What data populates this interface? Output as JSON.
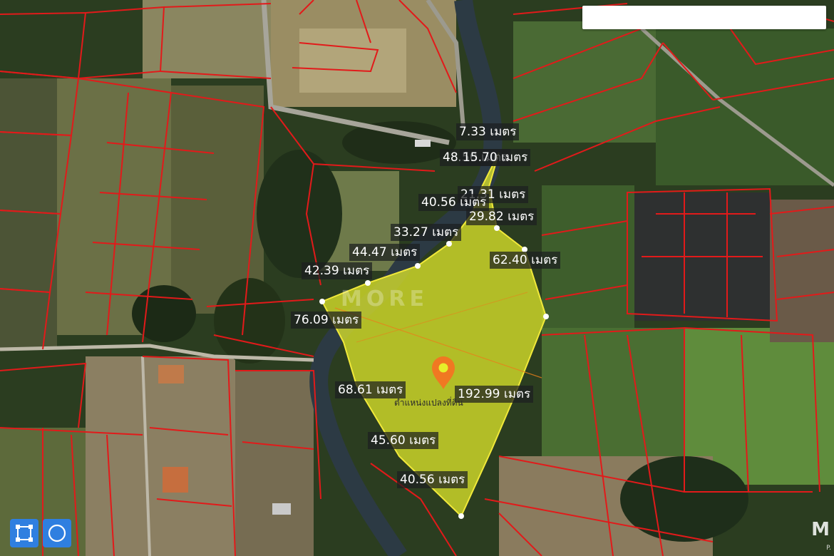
{
  "search": {
    "placeholder": ""
  },
  "colors": {
    "parcel_line": "#e21a1a",
    "polygon_fill": "#e6ef2a",
    "polygon_stroke": "#f1e93a",
    "pin": "#f07822",
    "tool_button": "#2f7fe0"
  },
  "measurements": [
    {
      "id": "m1",
      "text": "7.33 เมตร"
    },
    {
      "id": "m2",
      "text": "48.50 เมตร"
    },
    {
      "id": "m3",
      "text": "15.70 เมตร"
    },
    {
      "id": "m4",
      "text": "21.31 เมตร"
    },
    {
      "id": "m5",
      "text": "40.56 เมตร"
    },
    {
      "id": "m6",
      "text": "29.82 เมตร"
    },
    {
      "id": "m7",
      "text": "33.27 เมตร"
    },
    {
      "id": "m8",
      "text": "44.47 เมตร"
    },
    {
      "id": "m9",
      "text": "62.40 เมตร"
    },
    {
      "id": "m10",
      "text": "42.39 เมตร"
    },
    {
      "id": "m11",
      "text": "76.09 เมตร"
    },
    {
      "id": "m12",
      "text": "68.61 เมตร"
    },
    {
      "id": "m13",
      "text": "192.99 เมตร"
    },
    {
      "id": "m14",
      "text": "45.60 เมตร"
    },
    {
      "id": "m15",
      "text": "40.56 เมตร"
    }
  ],
  "pin": {
    "icon": "location-pin-icon",
    "caption": "ตำแหน่งแปลงที่ดิน"
  },
  "watermark": "MORE",
  "corner_logo": {
    "text": "M",
    "sub": "P."
  },
  "tools": [
    {
      "id": "draw-rectangle",
      "icon": "square-select-icon"
    },
    {
      "id": "draw-circle",
      "icon": "circle-icon"
    }
  ]
}
